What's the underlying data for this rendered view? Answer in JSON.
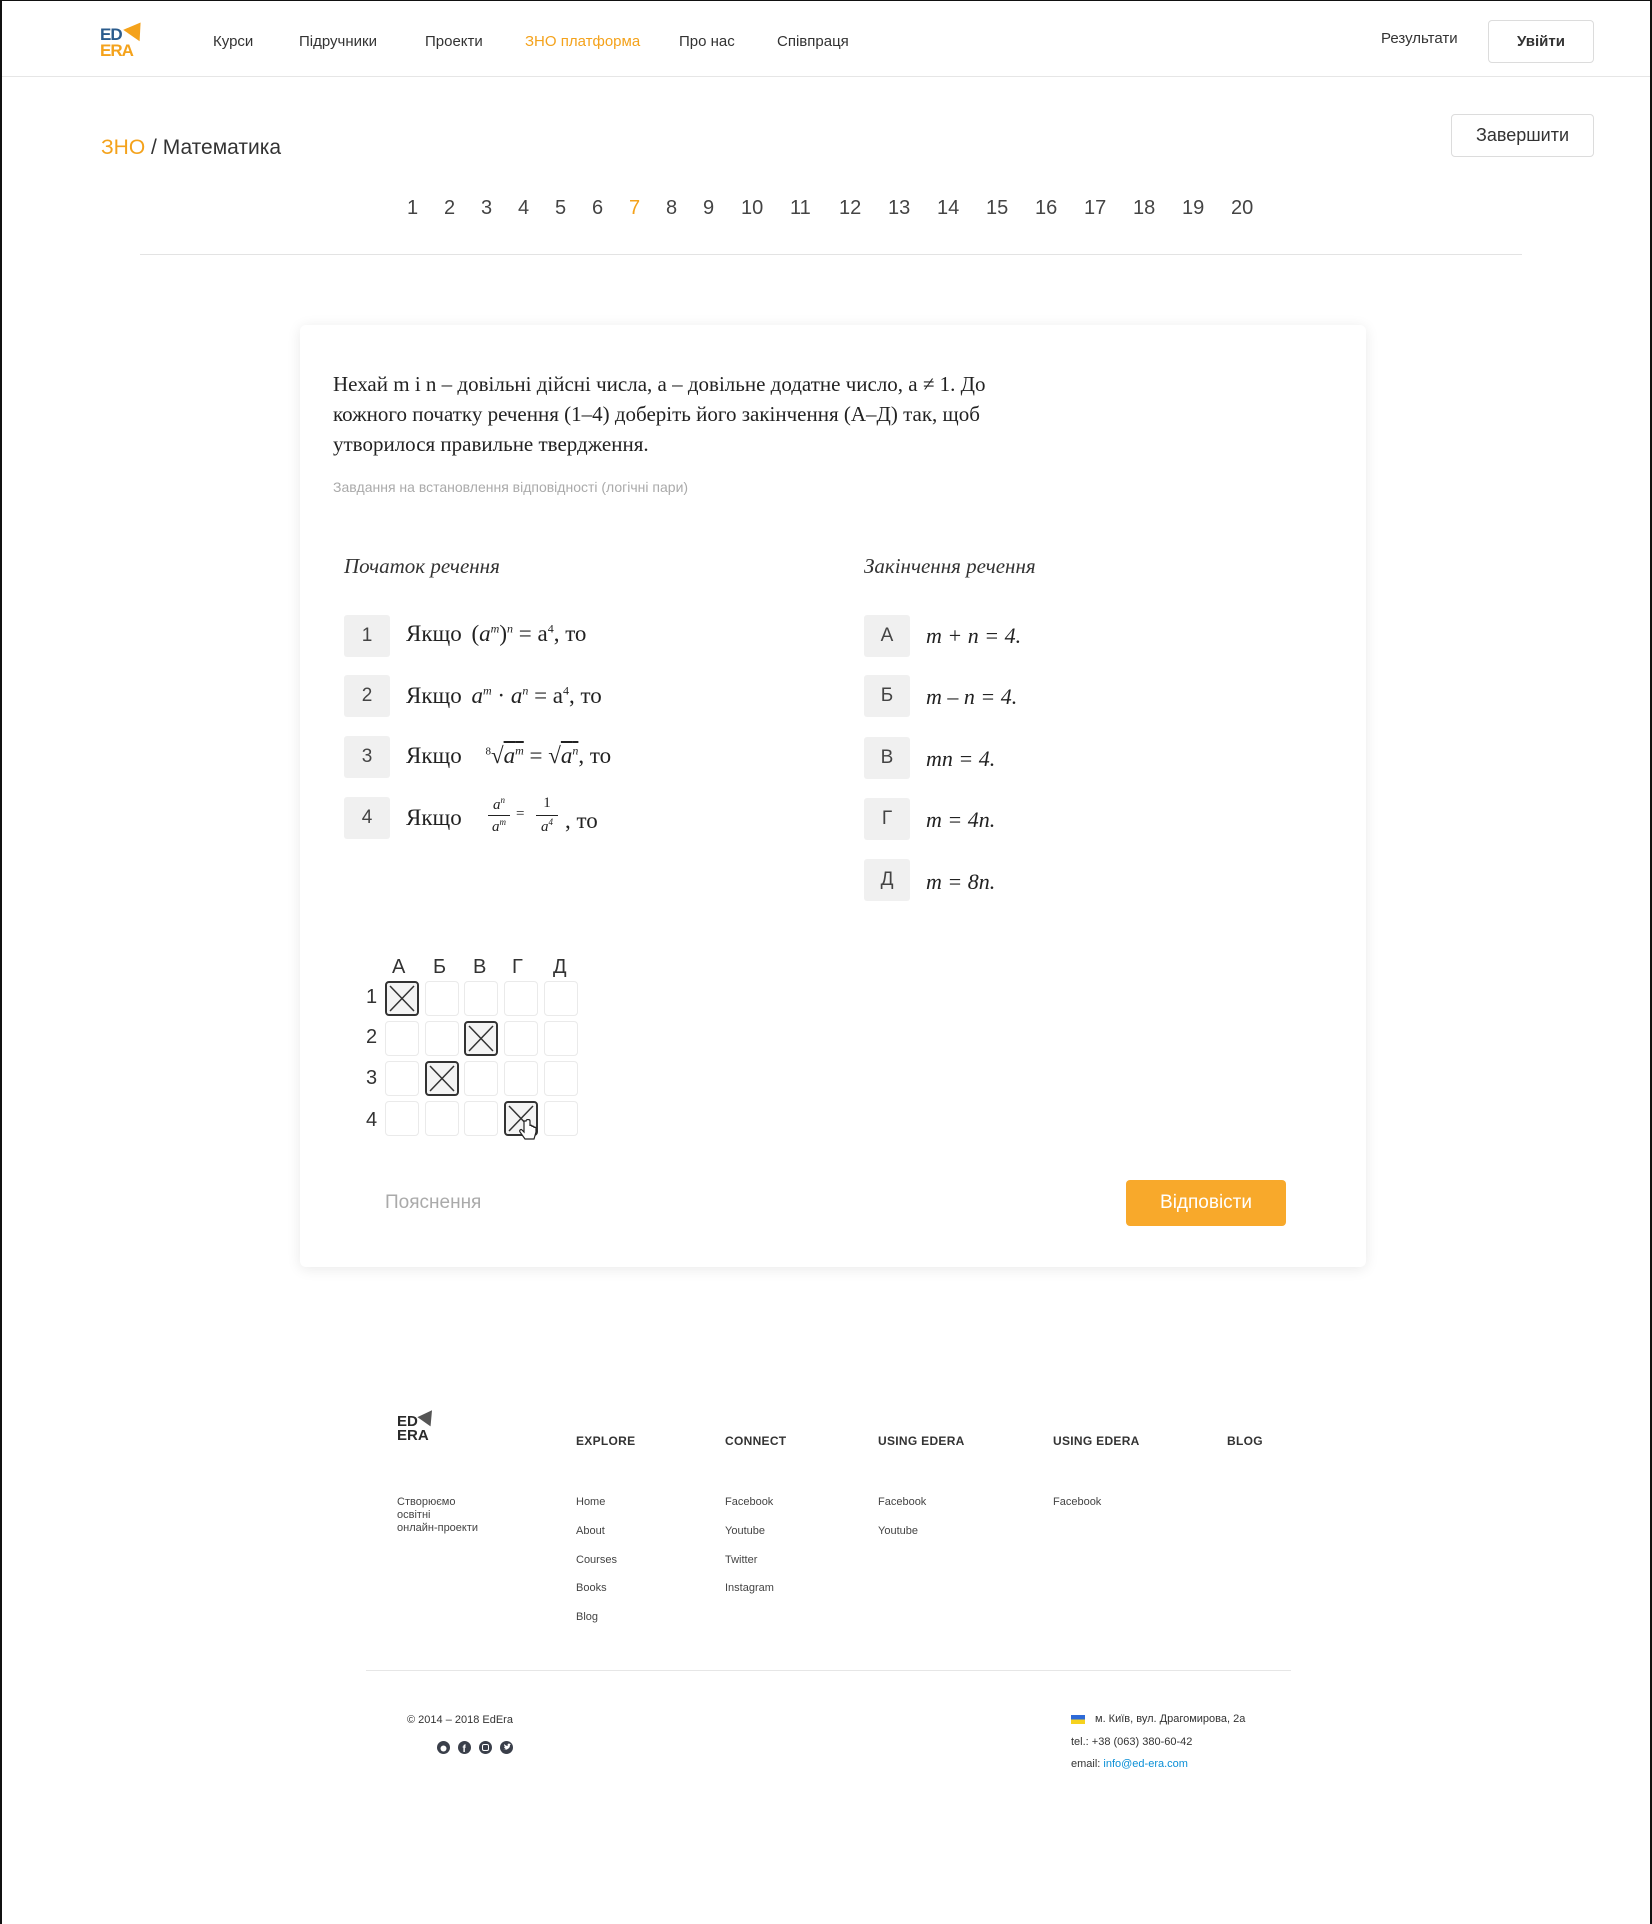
{
  "header": {
    "logo": {
      "top": "ED",
      "bottom": "ERA"
    },
    "nav": [
      "Курси",
      "Підручники",
      "Проекти",
      "ЗНО платформа",
      "Про нас",
      "Співпраця"
    ],
    "nav_active_index": 3,
    "results": "Результати",
    "login": "Увійти"
  },
  "breadcrumb": {
    "link": "ЗНО",
    "separator": "/",
    "current": "Математика"
  },
  "finish_button": "Завершити",
  "pager": {
    "pages": [
      "1",
      "2",
      "3",
      "4",
      "5",
      "6",
      "7",
      "8",
      "9",
      "10",
      "11",
      "12",
      "13",
      "14",
      "15",
      "16",
      "17",
      "18",
      "19",
      "20"
    ],
    "current": "7"
  },
  "question": {
    "lines": [
      "Нехай m і n – довільні дійсні числа, a – довільне додатне число, a ≠ 1. До",
      "кожного початку речення (1–4) доберіть його закінчення (А–Д) так, щоб",
      "утворилося правильне твердження."
    ],
    "type": "Завдання на встановлення відповідності (логічні пари)",
    "left_header": "Початок речення",
    "right_header": "Закінчення речення",
    "beginnings": [
      {
        "num": "1",
        "word": "Якщо",
        "tail": ", то"
      },
      {
        "num": "2",
        "word": "Якщо",
        "tail": ", то"
      },
      {
        "num": "3",
        "word": "Якщо",
        "tail": ", то"
      },
      {
        "num": "4",
        "word": "Якщо",
        "tail": ", то"
      }
    ],
    "endings": [
      {
        "letter": "А",
        "text": "m + n = 4."
      },
      {
        "letter": "Б",
        "text": "m – n = 4."
      },
      {
        "letter": "В",
        "text": "mn = 4."
      },
      {
        "letter": "Г",
        "text": "m = 4n."
      },
      {
        "letter": "Д",
        "text": "m = 8n."
      }
    ]
  },
  "answer_grid": {
    "columns": [
      "А",
      "Б",
      "В",
      "Г",
      "Д"
    ],
    "rows": [
      "1",
      "2",
      "3",
      "4"
    ],
    "selected": {
      "1": "А",
      "2": "В",
      "3": "Б",
      "4": "Г"
    }
  },
  "explain_link": "Пояснення",
  "answer_button": "Відповісти",
  "footer": {
    "logo": {
      "top": "ED",
      "bottom": "ERA"
    },
    "tagline": [
      "Створюємо",
      "освітні",
      "онлайн-проекти"
    ],
    "columns": [
      {
        "title": "EXPLORE",
        "links": [
          "Home",
          "About",
          "Courses",
          "Books",
          "Blog"
        ]
      },
      {
        "title": "CONNECT",
        "links": [
          "Facebook",
          "Youtube",
          "Twitter",
          "Instagram"
        ]
      },
      {
        "title": "USING EDERA",
        "links": [
          "Facebook",
          "Youtube"
        ]
      },
      {
        "title": "USING EDERA",
        "links": [
          "Facebook"
        ]
      },
      {
        "title": "BLOG",
        "links": []
      }
    ],
    "copyright": "© 2014 – 2018  EdEra",
    "social_icons": [
      "reddit-icon",
      "facebook-icon",
      "instagram-icon",
      "twitter-icon"
    ],
    "address": "м. Київ, вул. Драгомирова, 2а",
    "tel": "tel.: +38 (063) 380-60-42",
    "email_label": "email:",
    "email": "info@ed-era.com"
  },
  "colors": {
    "accent": "#f8a92b",
    "brand_blue": "#2a5b8c",
    "link_blue": "#0a8fd6"
  }
}
